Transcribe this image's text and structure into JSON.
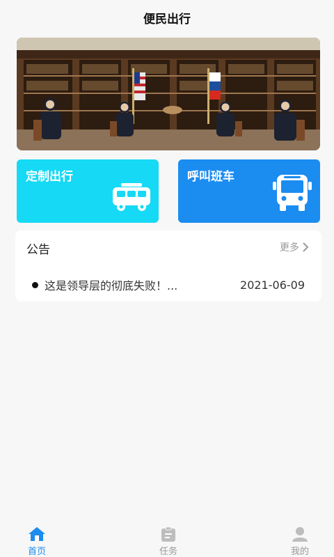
{
  "header": {
    "title": "便民出行"
  },
  "banner": {
    "icon": "photo-banner"
  },
  "cards": {
    "left": {
      "label": "定制出行",
      "icon": "minibus-icon"
    },
    "right": {
      "label": "呼叫班车",
      "icon": "bus-icon"
    }
  },
  "notice": {
    "title": "公告",
    "more": "更多",
    "items": [
      {
        "text": "这是领导层的彻底失败！...",
        "date": "2021-06-09"
      }
    ]
  },
  "tabbar": {
    "active_color": "#1b8cf0",
    "items": [
      {
        "label": "首页",
        "icon": "home-icon"
      },
      {
        "label": "任务",
        "icon": "clipboard-icon"
      },
      {
        "label": "我的",
        "icon": "user-icon"
      }
    ]
  }
}
